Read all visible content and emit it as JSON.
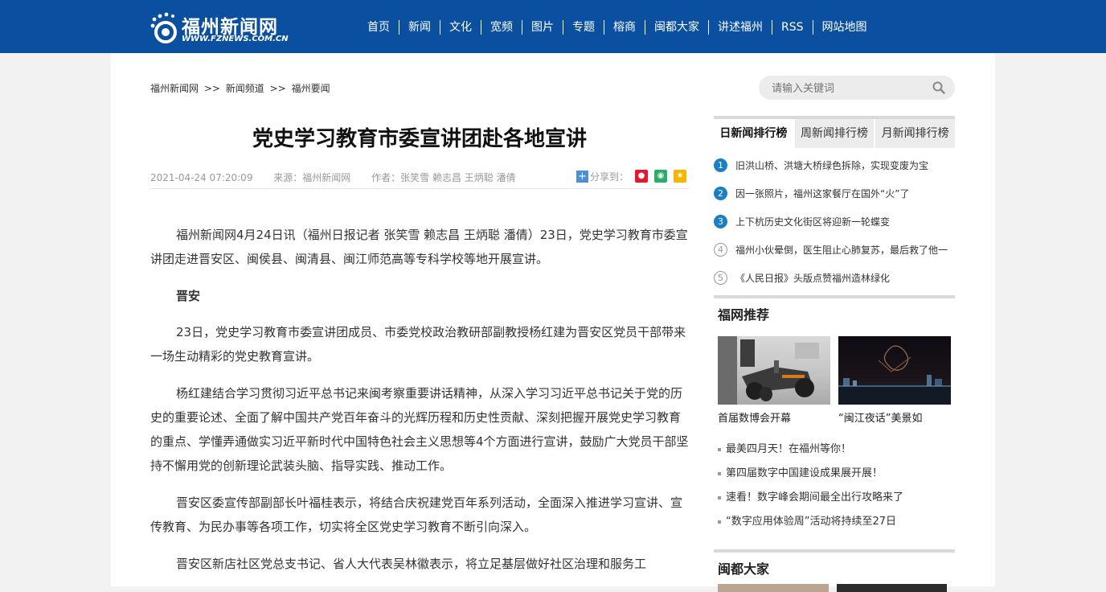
{
  "header": {
    "logo_cn": "福州新闻网",
    "logo_en": "WWW.FZNEWS.COM.CN",
    "nav": [
      "首页",
      "新闻",
      "文化",
      "宽频",
      "图片",
      "专题",
      "榕商",
      "闽都大家",
      "讲述福州",
      "RSS",
      "网站地图"
    ]
  },
  "breadcrumb": [
    "福州新闻网",
    ">>",
    "新闻频道",
    ">>",
    "福州要闻"
  ],
  "article": {
    "title": "党史学习教育市委宣讲团赴各地宣讲",
    "datetime": "2021-04-24 07:20:09",
    "source": "来源：福州新闻网",
    "author": "作者：张笑雪 赖志昌 王炳聪 潘倩",
    "share_label": "分享到：",
    "paragraphs": [
      {
        "type": "text",
        "text": "福州新闻网4月24日讯（福州日报记者 张笑雪 赖志昌 王炳聪 潘倩）23日，党史学习教育市委宣讲团走进晋安区、闽侯县、闽清县、闽江师范高等专科学校等地开展宣讲。"
      },
      {
        "type": "sub",
        "text": "晋安"
      },
      {
        "type": "text",
        "text": "23日，党史学习教育市委宣讲团成员、市委党校政治教研部副教授杨红建为晋安区党员干部带来一场生动精彩的党史教育宣讲。"
      },
      {
        "type": "text",
        "text": "杨红建结合学习贯彻习近平总书记来闽考察重要讲话精神，从深入学习习近平总书记关于党的历史的重要论述、全面了解中国共产党百年奋斗的光辉历程和历史性贡献、深刻把握开展党史学习教育的重点、学懂弄通做实习近平新时代中国特色社会主义思想等4个方面进行宣讲，鼓励广大党员干部坚持不懈用党的创新理论武装头脑、指导实践、推动工作。"
      },
      {
        "type": "text",
        "text": "晋安区委宣传部副部长叶福桂表示，将结合庆祝建党百年系列活动，全面深入推进学习宣讲、宣传教育、为民办事等各项工作，切实将全区党史学习教育不断引向深入。"
      },
      {
        "type": "text",
        "text": "晋安区新店社区党总支书记、省人大代表吴林徽表示，将立足基层做好社区治理和服务工"
      }
    ]
  },
  "search": {
    "placeholder": "请输入关键词"
  },
  "ranking": {
    "tabs": [
      "日新闻排行榜",
      "周新闻排行榜",
      "月新闻排行榜"
    ],
    "items": [
      {
        "num": "1",
        "text": "旧洪山桥、洪塘大桥绿色拆除，实现变废为宝"
      },
      {
        "num": "2",
        "text": "因一张照片，福州这家餐厅在国外“火”了"
      },
      {
        "num": "3",
        "text": "上下杭历史文化街区将迎新一轮蝶变"
      },
      {
        "num": "4",
        "text": "福州小伙晕倒，医生阻止心肺复苏，最后救了他一"
      },
      {
        "num": "5",
        "text": "《人民日报》头版点赞福州造林绿化"
      }
    ]
  },
  "fuwang": {
    "title": "福网推荐",
    "pics": [
      {
        "caption": "首届数博会开幕"
      },
      {
        "caption": "“闽江夜话”美景如"
      }
    ],
    "list": [
      "最美四月天！在福州等你！",
      "第四届数字中国建设成果展开展！",
      "速看！数字峰会期间最全出行攻略来了",
      "“数字应用体验周”活动将持续至27日"
    ]
  },
  "mindu": {
    "title": "闽都大家"
  },
  "colors": {
    "header_bg": "#0b4fa0",
    "rank_hot": "#1a7ec8"
  }
}
